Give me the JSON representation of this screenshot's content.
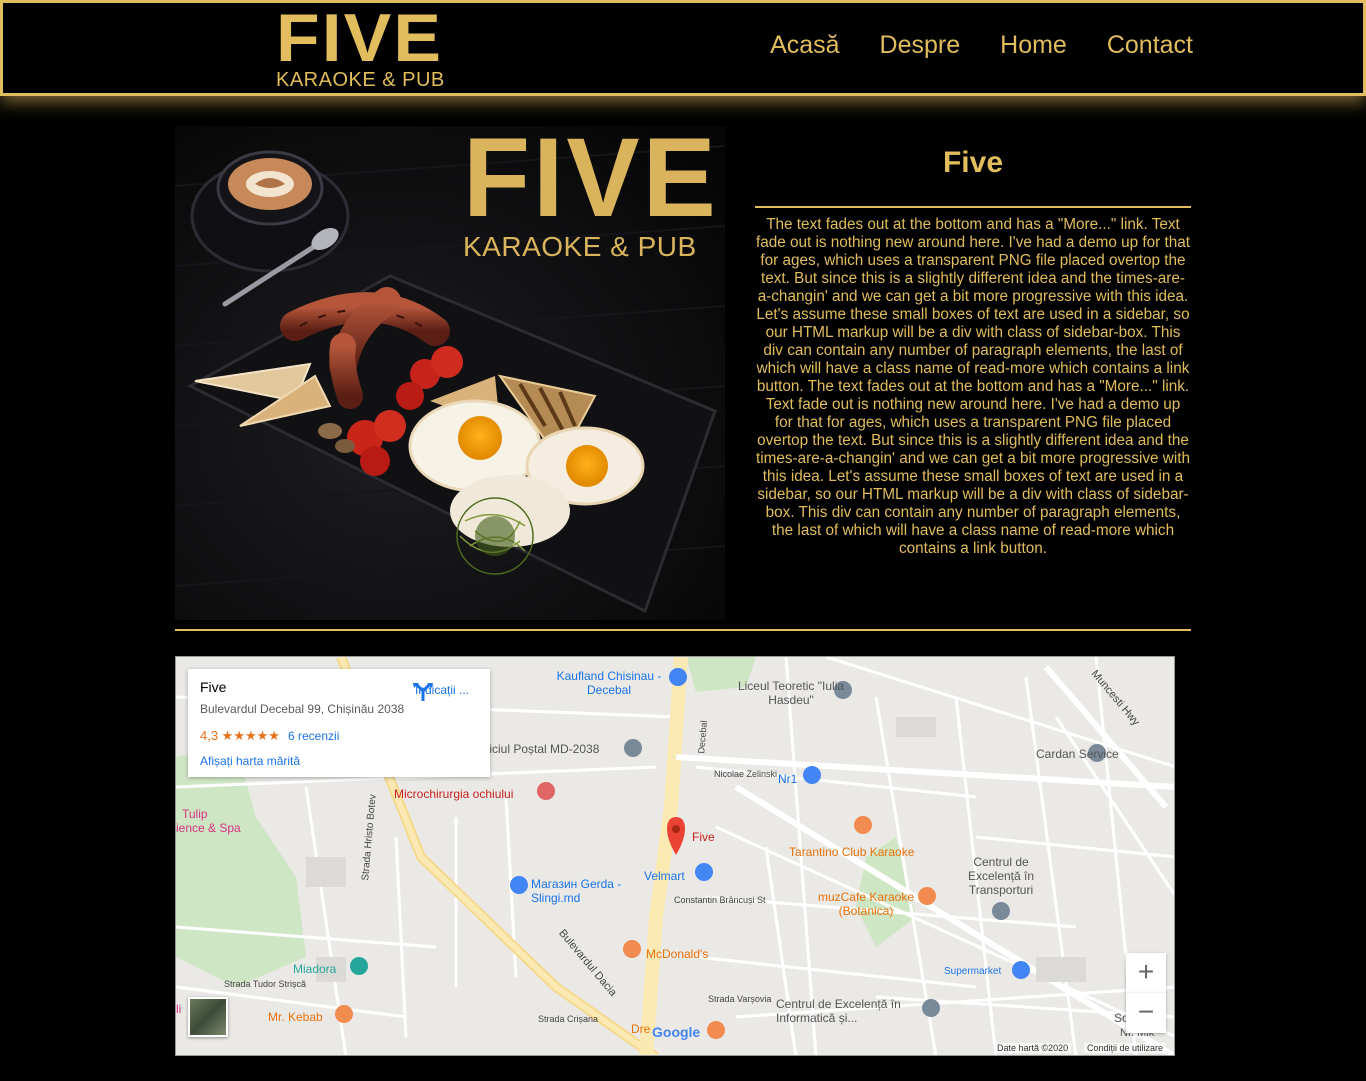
{
  "header": {
    "logo_big": "FIVE",
    "logo_small": "KARAOKE & PUB",
    "nav": [
      "Acasă",
      "Despre",
      "Home",
      "Contact"
    ]
  },
  "hero": {
    "logo_big": "FIVE",
    "logo_small": "KARAOKE & PUB"
  },
  "about": {
    "title": "Five",
    "text": "The text fades out at the bottom and has a \"More...\" link. Text fade out is nothing new around here. I've had a demo up for that for ages, which uses a transparent PNG file placed overtop the text. But since this is a slightly different idea and the times-are-a-changin' and we can get a bit more progressive with this idea. Let's assume these small boxes of text are used in a sidebar, so our HTML markup will be a div with class of sidebar-box. This div can contain any number of paragraph elements, the last of which will have a class name of read-more which contains a link button. The text fades out at the bottom and has a \"More...\" link. Text fade out is nothing new around here. I've had a demo up for that for ages, which uses a transparent PNG file placed overtop the text. But since this is a slightly different idea and the times-are-a-changin' and we can get a bit more progressive with this idea. Let's assume these small boxes of text are used in a sidebar, so our HTML markup will be a div with class of sidebar-box. This div can contain any number of paragraph elements, the last of which will have a class name of read-more which contains a link button."
  },
  "map": {
    "place_name": "Five",
    "address": "Bulevardul Decebal 99, Chișinău 2038",
    "rating": "4,3 ★★★★★",
    "reviews": "6 recenzii",
    "directions": "Indicații ...",
    "larger_map": "Afișați harta mărită",
    "zoom_in": "+",
    "zoom_out": "−",
    "footer_data": "Date hartă ©2020",
    "footer_terms": "Condiții de utilizare",
    "google": "Google",
    "labels": {
      "kaufland": "Kaufland Chisinau - Decebal",
      "liceu": "Liceul Teoretic \"Iulia Hasdeu\"",
      "oficiul": "ficiul Poștal MD-2038",
      "cardan": "Cardan Service",
      "nr1": "Nr1",
      "microchirurgia": "Microchirurgia ochiului",
      "tulip": "Tulip",
      "spa": "ience & Spa",
      "five": "Five",
      "tarantino": "Tarantino Club Karaoke",
      "centrul_transport": "Centrul de Excelență în Transporturi",
      "velmart": "Velmart",
      "gerda": "Магазин Gerda -Slingi.md",
      "muzcafe": "muzCafe Karaoke (Botanica)",
      "mcdonalds": "McDonald's",
      "miadora": "Miadora",
      "supermarket": "Supermarket",
      "mrkebab": "Mr. Kebab",
      "centrul_informatica": "Centrul de Excelență în Informatică și...",
      "bulevardul_dacia": "Bulevardul Dacia",
      "muncesti": "Muncesti Hwy",
      "strada_hristo": "Strada Hristo Botev",
      "nicolae": "Nicolae Zelinski",
      "decebal": "Decebal",
      "constantin": "Constantin Brâncuși St",
      "varsovia": "Strada Varșovia",
      "tudor": "Strada Tudor Strișcă",
      "crisana": "Strada Crișana",
      "dre": "Dre",
      "soni": "So",
      "nrs": "Nr. Mik",
      "clinica": "li"
    }
  },
  "colors": {
    "gold": "#e1bd5d",
    "background": "#000000"
  }
}
